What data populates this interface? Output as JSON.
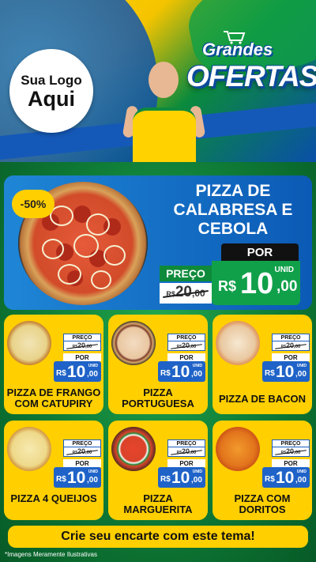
{
  "header": {
    "logo_line1": "Sua Logo",
    "logo_line2": "Aqui",
    "title_small": "Grandes",
    "title_big": "OFERTAS"
  },
  "featured": {
    "discount": "-50%",
    "name_lines": [
      "PIZZA DE",
      "CALABRESA E",
      "CEBOLA"
    ],
    "por_label": "POR",
    "preco_label": "PREÇO",
    "old_currency": "R$",
    "old_int": "20",
    "old_dec": ",00",
    "unid": "UNID",
    "new_currency": "R$",
    "new_int": "10",
    "new_dec": ",00"
  },
  "labels": {
    "preco": "PREÇO",
    "por": "POR",
    "unid": "UNID",
    "currency": "R$"
  },
  "products": [
    {
      "name": "PIZZA DE FRANGO COM CATUPIRY",
      "old_int": "20",
      "old_dec": ",00",
      "new_int": "10",
      "new_dec": ",00"
    },
    {
      "name": "PIZZA PORTUGUESA",
      "old_int": "20",
      "old_dec": ",00",
      "new_int": "10",
      "new_dec": ",00"
    },
    {
      "name": "PIZZA DE BACON",
      "old_int": "20",
      "old_dec": ",00",
      "new_int": "10",
      "new_dec": ",00"
    },
    {
      "name": "PIZZA 4 QUEIJOS",
      "old_int": "20",
      "old_dec": ",00",
      "new_int": "10",
      "new_dec": ",00"
    },
    {
      "name": "PIZZA MARGUERITA",
      "old_int": "20",
      "old_dec": ",00",
      "new_int": "10",
      "new_dec": ",00"
    },
    {
      "name": "PIZZA COM DORITOS",
      "old_int": "20",
      "old_dec": ",00",
      "new_int": "10",
      "new_dec": ",00"
    }
  ],
  "cta": "Crie seu encarte com este tema!",
  "disclaimer": "*Imagens Meramente Ilustrativas",
  "colors": {
    "yellow": "#ffcf00",
    "green": "#11a04a",
    "blue": "#1f63c8"
  }
}
